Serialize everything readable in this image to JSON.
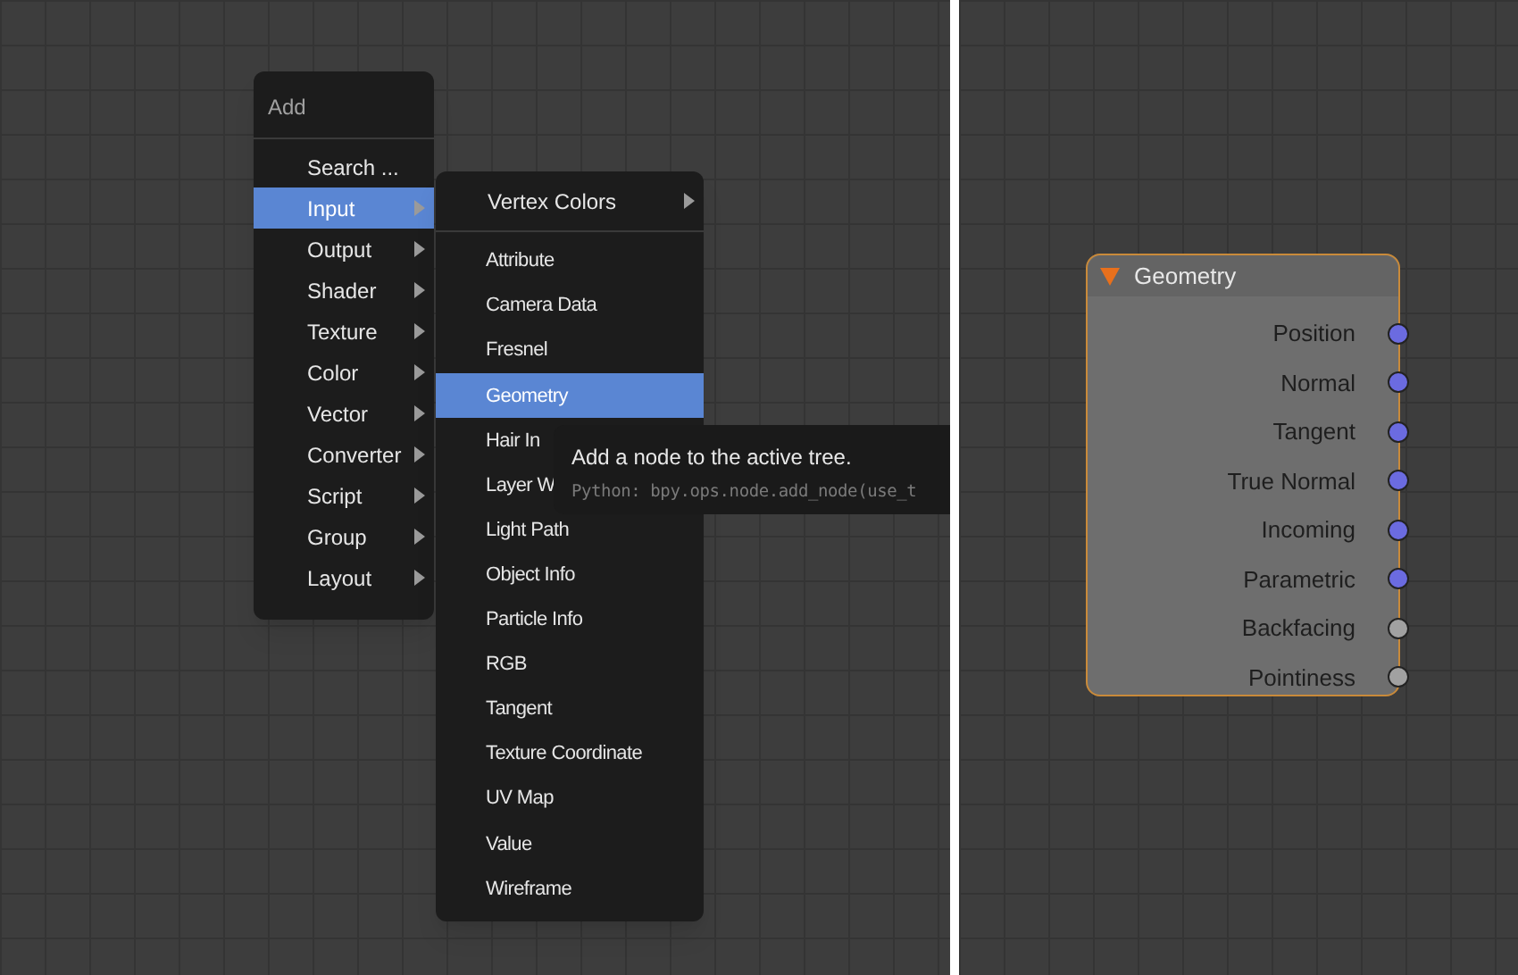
{
  "add_menu": {
    "title": "Add",
    "items": [
      {
        "label": "Search ...",
        "submenu": false,
        "selected": false
      },
      {
        "label": "Input",
        "submenu": true,
        "selected": true
      },
      {
        "label": "Output",
        "submenu": true,
        "selected": false
      },
      {
        "label": "Shader",
        "submenu": true,
        "selected": false
      },
      {
        "label": "Texture",
        "submenu": true,
        "selected": false
      },
      {
        "label": "Color",
        "submenu": true,
        "selected": false
      },
      {
        "label": "Vector",
        "submenu": true,
        "selected": false
      },
      {
        "label": "Converter",
        "submenu": true,
        "selected": false
      },
      {
        "label": "Script",
        "submenu": true,
        "selected": false
      },
      {
        "label": "Group",
        "submenu": true,
        "selected": false
      },
      {
        "label": "Layout",
        "submenu": true,
        "selected": false
      }
    ]
  },
  "input_submenu": {
    "header_item": {
      "label": "Vertex Colors",
      "submenu": true
    },
    "items": [
      {
        "label": "Attribute",
        "selected": false
      },
      {
        "label": "Camera Data",
        "selected": false
      },
      {
        "label": "Fresnel",
        "selected": false
      },
      {
        "label": "Geometry",
        "selected": true
      },
      {
        "label": "Hair In",
        "selected": false
      },
      {
        "label": "Layer W",
        "selected": false
      },
      {
        "label": "Light Path",
        "selected": false
      },
      {
        "label": "Object Info",
        "selected": false
      },
      {
        "label": "Particle Info",
        "selected": false
      },
      {
        "label": "RGB",
        "selected": false
      },
      {
        "label": "Tangent",
        "selected": false
      },
      {
        "label": "Texture Coordinate",
        "selected": false
      },
      {
        "label": "UV Map",
        "selected": false
      },
      {
        "label": "Value",
        "selected": false
      },
      {
        "label": "Wireframe",
        "selected": false
      }
    ]
  },
  "tooltip": {
    "description": "Add a node to the active tree.",
    "python": "Python: bpy.ops.node.add_node(use_t"
  },
  "node": {
    "title": "Geometry",
    "expanded": true,
    "outputs": [
      {
        "label": "Position",
        "color": "#6b6be0"
      },
      {
        "label": "Normal",
        "color": "#6b6be0"
      },
      {
        "label": "Tangent",
        "color": "#6b6be0"
      },
      {
        "label": "True Normal",
        "color": "#6b6be0"
      },
      {
        "label": "Incoming",
        "color": "#6b6be0"
      },
      {
        "label": "Parametric",
        "color": "#6b6be0"
      },
      {
        "label": "Backfacing",
        "color": "#a1a1a1"
      },
      {
        "label": "Pointiness",
        "color": "#a1a1a1"
      }
    ]
  }
}
